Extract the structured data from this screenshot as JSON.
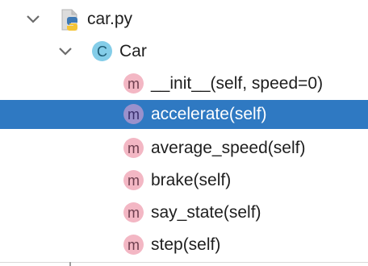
{
  "tree": {
    "file": {
      "label": "car.py",
      "icon": "python-file-icon",
      "expanded": true
    },
    "class": {
      "label": "Car",
      "badge": "C",
      "icon": "class-icon",
      "expanded": true
    },
    "methods": [
      {
        "label": "__init__(self, speed=0)",
        "badge": "m",
        "selected": false
      },
      {
        "label": "accelerate(self)",
        "badge": "m",
        "selected": true
      },
      {
        "label": "average_speed(self)",
        "badge": "m",
        "selected": false
      },
      {
        "label": "brake(self)",
        "badge": "m",
        "selected": false
      },
      {
        "label": "say_state(self)",
        "badge": "m",
        "selected": false
      },
      {
        "label": "step(self)",
        "badge": "m",
        "selected": false
      }
    ]
  },
  "colors": {
    "selection": "#2f79c2",
    "method_badge": "#f3b7c4",
    "method_badge_selected": "#9a91cc",
    "class_badge": "#84cde8"
  }
}
